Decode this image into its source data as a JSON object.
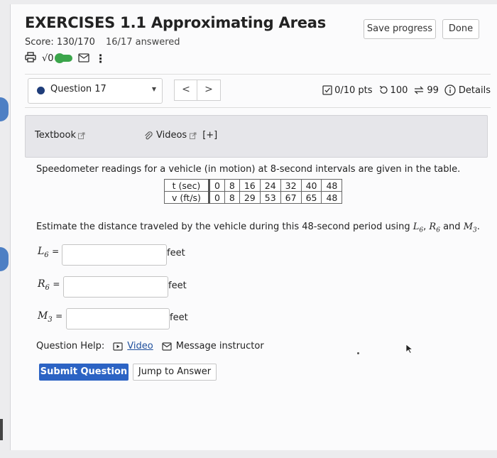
{
  "header": {
    "title": "EXERCISES 1.1 Approximating Areas",
    "score": "Score: 130/170",
    "answered": "16/17 answered",
    "save_label": "Save progress",
    "done_label": "Done"
  },
  "toolbar": {
    "sqrt_label": "√0",
    "more_label": "⋮"
  },
  "question_bar": {
    "question_label": "Question 17",
    "prev": "<",
    "next": ">",
    "points": "0/10 pts",
    "retries": "100",
    "attempts": "99",
    "details": "Details"
  },
  "resources": {
    "textbook": "Textbook",
    "videos": "Videos",
    "plus": "[+]"
  },
  "problem": {
    "intro": "Speedometer readings for a vehicle (in motion) at 8-second intervals are given in the table.",
    "table": {
      "row1_label": "t (sec)",
      "row1": [
        "0",
        "8",
        "16",
        "24",
        "32",
        "40",
        "48"
      ],
      "row2_label": "v (ft/s)",
      "row2": [
        "0",
        "8",
        "29",
        "53",
        "67",
        "65",
        "48"
      ]
    },
    "estimate": "Estimate the distance traveled by the vehicle during this 48-second period using",
    "vars": {
      "l": "L",
      "l_sub": "6",
      "r": "R",
      "r_sub": "6",
      "m": "M",
      "m_sub": "3"
    },
    "and_text": "and"
  },
  "answers": {
    "l6_label_main": "L",
    "l6_label_sub": "6",
    "r6_label_main": "R",
    "r6_label_sub": "6",
    "m3_label_main": "M",
    "m3_label_sub": "3",
    "equals": "=",
    "unit": "feet",
    "l6_value": "",
    "r6_value": "",
    "m3_value": ""
  },
  "help": {
    "label": "Question Help:",
    "video": "Video",
    "message": "Message instructor"
  },
  "actions": {
    "submit": "Submit Question",
    "jump": "Jump to Answer"
  }
}
